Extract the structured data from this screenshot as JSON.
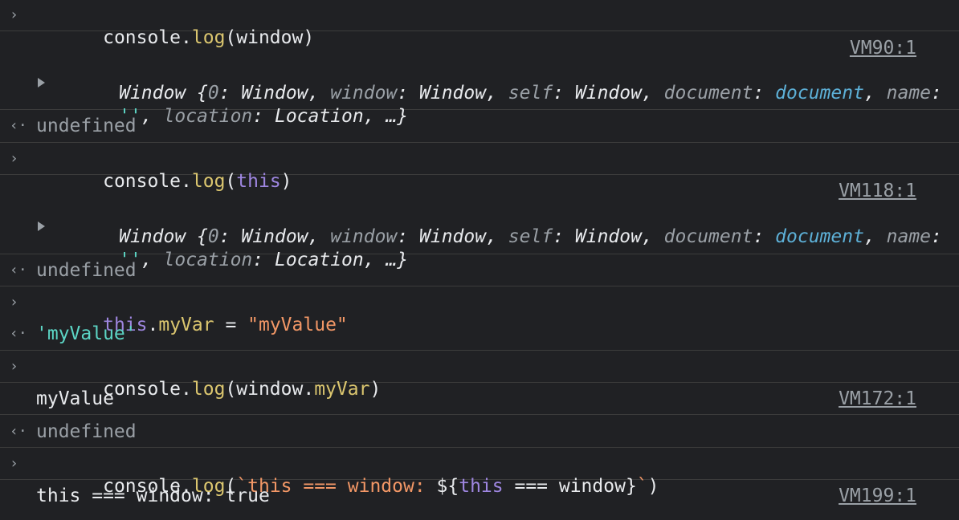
{
  "log_entries": [
    {
      "type": "input",
      "parts": [
        {
          "text": "console.",
          "cls": "plain"
        },
        {
          "text": "log",
          "cls": "fn"
        },
        {
          "text": "(window)",
          "cls": "plain"
        }
      ]
    },
    {
      "type": "output-object",
      "source": "VM90:1",
      "line1": [
        {
          "text": "Window {",
          "cls": "plain"
        },
        {
          "text": "0",
          "cls": "k"
        },
        {
          "text": ": Window, ",
          "cls": "plain"
        },
        {
          "text": "window",
          "cls": "k"
        },
        {
          "text": ": Window, ",
          "cls": "plain"
        },
        {
          "text": "self",
          "cls": "k"
        },
        {
          "text": ": Window, ",
          "cls": "plain"
        },
        {
          "text": "document",
          "cls": "k"
        },
        {
          "text": ": ",
          "cls": "plain"
        },
        {
          "text": "document",
          "cls": "doc"
        },
        {
          "text": ", ",
          "cls": "plain"
        },
        {
          "text": "name",
          "cls": "k"
        },
        {
          "text": ":",
          "cls": "plain"
        }
      ],
      "line2": [
        {
          "text": "''",
          "cls": "q"
        },
        {
          "text": ", ",
          "cls": "plain"
        },
        {
          "text": "location",
          "cls": "k"
        },
        {
          "text": ": Location, …}",
          "cls": "plain"
        }
      ]
    },
    {
      "type": "return",
      "text": "undefined"
    },
    {
      "type": "input",
      "parts": [
        {
          "text": "console.",
          "cls": "plain"
        },
        {
          "text": "log",
          "cls": "fn"
        },
        {
          "text": "(",
          "cls": "plain"
        },
        {
          "text": "this",
          "cls": "kw"
        },
        {
          "text": ")",
          "cls": "plain"
        }
      ]
    },
    {
      "type": "output-object",
      "source": "VM118:1",
      "line1": [
        {
          "text": "Window {",
          "cls": "plain"
        },
        {
          "text": "0",
          "cls": "k"
        },
        {
          "text": ": Window, ",
          "cls": "plain"
        },
        {
          "text": "window",
          "cls": "k"
        },
        {
          "text": ": Window, ",
          "cls": "plain"
        },
        {
          "text": "self",
          "cls": "k"
        },
        {
          "text": ": Window, ",
          "cls": "plain"
        },
        {
          "text": "document",
          "cls": "k"
        },
        {
          "text": ": ",
          "cls": "plain"
        },
        {
          "text": "document",
          "cls": "doc"
        },
        {
          "text": ", ",
          "cls": "plain"
        },
        {
          "text": "name",
          "cls": "k"
        },
        {
          "text": ":",
          "cls": "plain"
        }
      ],
      "line2": [
        {
          "text": "''",
          "cls": "q"
        },
        {
          "text": ", ",
          "cls": "plain"
        },
        {
          "text": "location",
          "cls": "k"
        },
        {
          "text": ": Location, …}",
          "cls": "plain"
        }
      ]
    },
    {
      "type": "return",
      "text": "undefined"
    },
    {
      "type": "input-assign",
      "parts": [
        {
          "text": "this",
          "cls": "kw"
        },
        {
          "text": ".",
          "cls": "plain"
        },
        {
          "text": "myVar",
          "cls": "fn"
        },
        {
          "text": " = ",
          "cls": "plain"
        },
        {
          "text": "\"myValue\"",
          "cls": "str"
        }
      ],
      "result": "'myValue'"
    },
    {
      "type": "input",
      "parts": [
        {
          "text": "console.",
          "cls": "plain"
        },
        {
          "text": "log",
          "cls": "fn"
        },
        {
          "text": "(window.",
          "cls": "plain"
        },
        {
          "text": "myVar",
          "cls": "fn"
        },
        {
          "text": ")",
          "cls": "plain"
        }
      ]
    },
    {
      "type": "output",
      "text": "myValue",
      "source": "VM172:1"
    },
    {
      "type": "return",
      "text": "undefined"
    },
    {
      "type": "input",
      "parts": [
        {
          "text": "console.",
          "cls": "plain"
        },
        {
          "text": "log",
          "cls": "fn"
        },
        {
          "text": "(",
          "cls": "plain"
        },
        {
          "text": "`this === window: ",
          "cls": "tq"
        },
        {
          "text": "${",
          "cls": "plain"
        },
        {
          "text": "this",
          "cls": "kw"
        },
        {
          "text": " === window}",
          "cls": "plain"
        },
        {
          "text": "`",
          "cls": "tq"
        },
        {
          "text": ")",
          "cls": "plain"
        }
      ]
    },
    {
      "type": "output",
      "text": "this === window: true",
      "source": "VM199:1"
    }
  ],
  "icons": {
    "prompt": "›",
    "return": "‹·",
    "expand": "triangle-right"
  }
}
